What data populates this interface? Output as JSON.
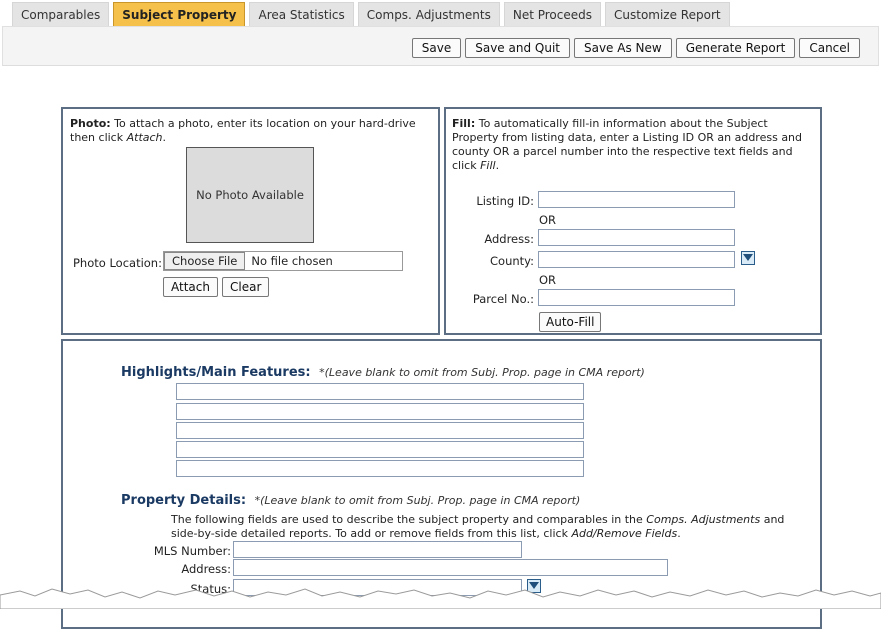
{
  "tabs": [
    {
      "label": "Comparables",
      "active": false
    },
    {
      "label": "Subject Property",
      "active": true
    },
    {
      "label": "Area Statistics",
      "active": false
    },
    {
      "label": "Comps. Adjustments",
      "active": false
    },
    {
      "label": "Net Proceeds",
      "active": false
    },
    {
      "label": "Customize Report",
      "active": false
    }
  ],
  "toolbar": {
    "save": "Save",
    "save_quit": "Save and Quit",
    "save_as_new": "Save As New",
    "generate_report": "Generate Report",
    "cancel": "Cancel"
  },
  "photo": {
    "heading": "Photo:",
    "instr_1": " To attach a photo, enter its location on your hard-drive then click ",
    "instr_action": "Attach",
    "instr_end": ".",
    "placeholder": "No Photo Available",
    "location_label": "Photo Location:",
    "choose_file": "Choose File",
    "no_file": "No file chosen",
    "attach": "Attach",
    "clear": "Clear"
  },
  "fill": {
    "heading": "Fill:",
    "instr": " To automatically fill-in information about the Subject Property from listing data, enter a Listing ID OR an address and county OR a parcel number into the respective text fields and click ",
    "instr_action": "Fill",
    "instr_end": ".",
    "listing_id_label": "Listing ID:",
    "or_1": "OR",
    "address_label": "Address:",
    "county_label": "County:",
    "or_2": "OR",
    "parcel_label": "Parcel No.:",
    "auto_fill": "Auto-Fill"
  },
  "highlights": {
    "title": "Highlights/Main Features:",
    "note": "*(Leave blank to omit from Subj. Prop. page in CMA report)"
  },
  "details": {
    "title": "Property Details:",
    "note": "*(Leave blank to omit from Subj. Prop. page in CMA report)",
    "desc_1": "The following fields are used to describe the subject property and comparables in the ",
    "desc_em": "Comps. Adjustments",
    "desc_2": " and side-by-side detailed reports. To add or remove fields from this list, click ",
    "desc_em2": "Add/Remove Fields",
    "desc_end": ".",
    "mls_label": "MLS Number:",
    "address_label": "Address:",
    "status_label": "Status:"
  },
  "colors": {
    "active_tab": "#f5c14a",
    "panel_border": "#5c6e84",
    "title": "#1b3a63"
  },
  "icons": [
    "dropdown-arrow-icon"
  ]
}
